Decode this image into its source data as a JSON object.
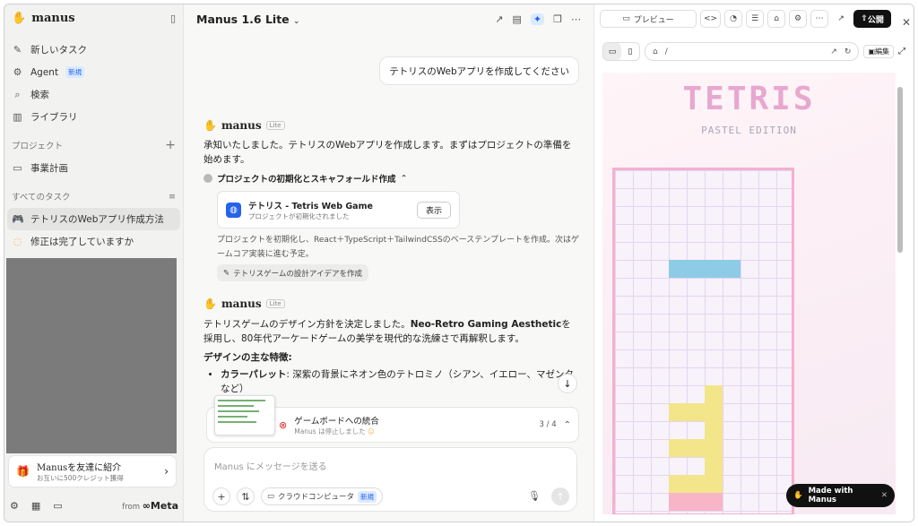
{
  "sidebar": {
    "brand": "manus",
    "items": [
      {
        "icon": "✎",
        "label": "新しいタスク"
      },
      {
        "icon": "⚙",
        "label": "Agent",
        "tag": "新規"
      },
      {
        "icon": "⌕",
        "label": "検索"
      },
      {
        "icon": "▥",
        "label": "ライブラリ"
      }
    ],
    "projects_header": "プロジェクト",
    "project_item": "事業計画",
    "tasks_header": "すべてのタスク",
    "task1": "テトリスのWebアプリ作成方法",
    "task2": "修正は完了していますか",
    "promo_title": "Manusを友達に紹介",
    "promo_sub": "お互いに500クレジット獲得",
    "footer_from": "from",
    "footer_meta": "Meta"
  },
  "chat": {
    "model": "Manus 1.6 Lite",
    "user_message": "テトリスのWebアプリを作成してください",
    "agent_name": "manus",
    "lite_badge": "Lite",
    "reply1": "承知いたしました。テトリスのWebアプリを作成します。まずはプロジェクトの準備を始めます。",
    "step_title": "プロジェクトの初期化とスキャフォールド作成",
    "card_title": "テトリス - Tetris Web Game",
    "card_sub": "プロジェクトが初期化されました",
    "card_button": "表示",
    "step_note": "プロジェクトを初期化し、React＋TypeScript＋TailwindCSSのベーステンプレートを作成。次はゲームコア実装に進む予定。",
    "chip": "テトリスゲームの設計アイデアを作成",
    "reply2_a": "テトリスゲームのデザイン方針を決定しました。",
    "reply2_b": "Neo-Retro Gaming Aesthetic",
    "reply2_c": "を採用し、80年代アーケードゲームの美学を現代的な洗練さで再解釈します。",
    "features_heading": "デザインの主な特徴:",
    "bullet_bold": "カラーパレット",
    "bullet_text": ": 深紫の背景にネオン色のテトロミノ（シアン、イエロー、マゼンタなど）",
    "task_title": "ゲームボードへの統合",
    "task_status": "Manus は停止しました",
    "task_count": "3 / 4",
    "input_placeholder": "Manus にメッセージを送る",
    "cloud_label": "クラウドコンピュータ",
    "cloud_tag": "新規"
  },
  "preview": {
    "preview_label": "プレビュー",
    "publish_label": "公開",
    "url": "/",
    "edit_label": "編集",
    "game_title": "TETRIS",
    "game_subtitle": "PASTEL EDITION",
    "made_with": "Made with Manus",
    "colors": {
      "cyan": "#8ecbe6",
      "yellow": "#f2e58a",
      "pink": "#f9b5c8"
    }
  }
}
